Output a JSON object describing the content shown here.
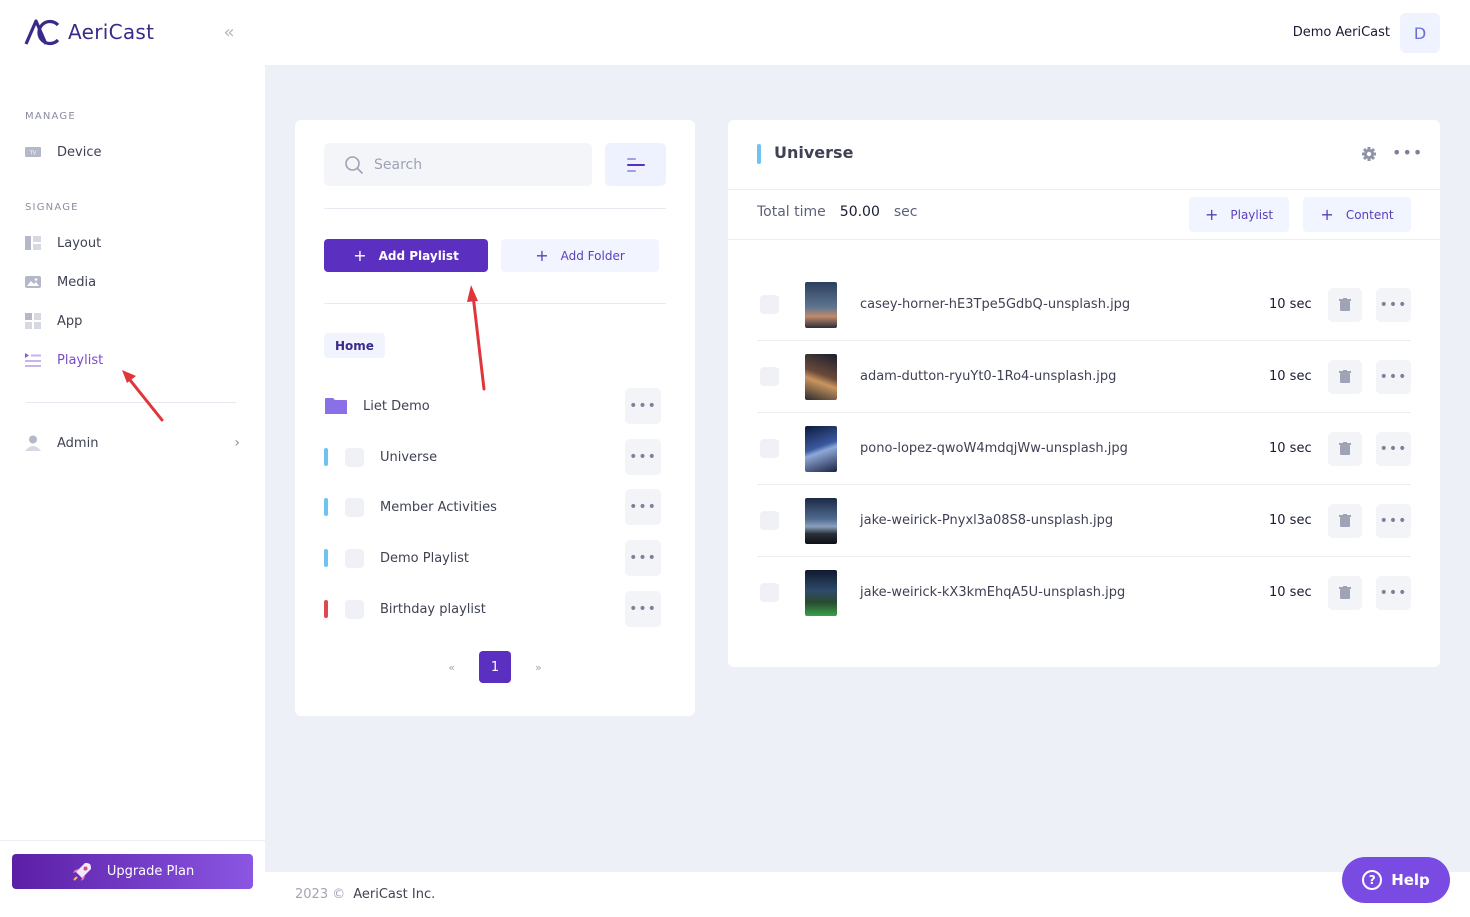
{
  "brand": {
    "name": "AeriCast"
  },
  "sidebar": {
    "manage_title": "MANAGE",
    "signage_title": "SIGNAGE",
    "items": [
      {
        "label": "Device",
        "icon": "tv-icon"
      },
      {
        "label": "Layout",
        "icon": "layout-icon"
      },
      {
        "label": "Media",
        "icon": "image-icon"
      },
      {
        "label": "App",
        "icon": "apps-icon"
      },
      {
        "label": "Playlist",
        "icon": "playlist-icon",
        "active": true
      },
      {
        "label": "Admin",
        "icon": "user-icon"
      }
    ],
    "upgrade_label": "Upgrade Plan"
  },
  "header": {
    "user_name": "Demo AeriCast",
    "avatar_initial": "D"
  },
  "playlists_panel": {
    "search_placeholder": "Search",
    "add_playlist_label": "Add Playlist",
    "add_folder_label": "Add Folder",
    "breadcrumb": "Home",
    "folder": {
      "label": "Liet Demo"
    },
    "items": [
      {
        "label": "Universe",
        "color": "#6ec3f0"
      },
      {
        "label": "Member Activities",
        "color": "#6ec3f0"
      },
      {
        "label": "Demo Playlist",
        "color": "#6ec3f0"
      },
      {
        "label": "Birthday playlist",
        "color": "#e0484f"
      }
    ],
    "pagination": {
      "prev": "«",
      "current": "1",
      "next": "»"
    }
  },
  "detail_panel": {
    "title": "Universe",
    "total_label": "Total time",
    "total_value": "50.00",
    "total_unit": "sec",
    "add_playlist_label": "Playlist",
    "add_content_label": "Content",
    "items": [
      {
        "name": "casey-horner-hE3Tpe5GdbQ-unsplash.jpg",
        "duration": "10 sec"
      },
      {
        "name": "adam-dutton-ryuYt0-1Ro4-unsplash.jpg",
        "duration": "10 sec"
      },
      {
        "name": "pono-lopez-qwoW4mdqjWw-unsplash.jpg",
        "duration": "10 sec"
      },
      {
        "name": "jake-weirick-Pnyxl3a08S8-unsplash.jpg",
        "duration": "10 sec"
      },
      {
        "name": "jake-weirick-kX3kmEhqA5U-unsplash.jpg",
        "duration": "10 sec"
      }
    ]
  },
  "footer": {
    "year": "2023 ©",
    "company": "AeriCast Inc."
  },
  "help_label": "Help",
  "colors": {
    "primary": "#5b2fbf",
    "accent": "#7a4be3",
    "annotation": "#e0353a"
  }
}
